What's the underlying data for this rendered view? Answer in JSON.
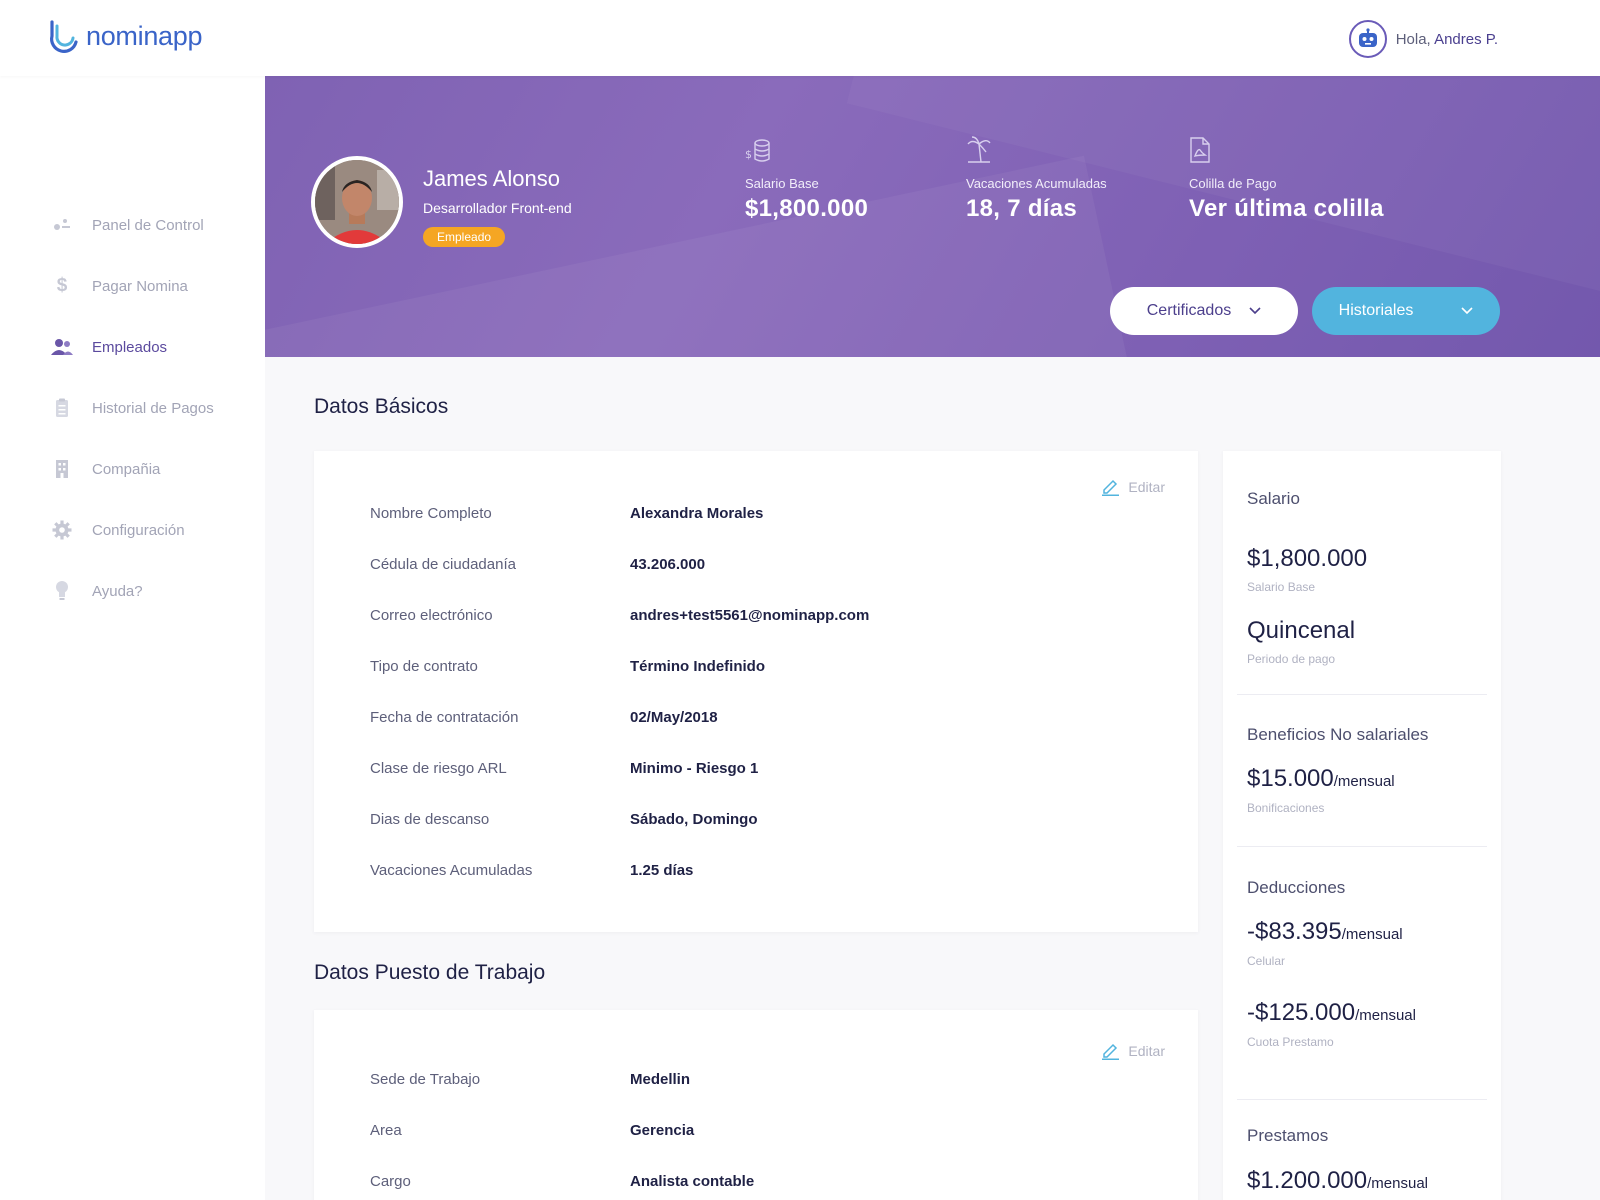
{
  "brand": {
    "name": "nominapp"
  },
  "user": {
    "greeting": "Hola,",
    "name": "Andres P."
  },
  "sidebar": {
    "items": [
      {
        "label": "Panel de Control",
        "icon": "dashboard-icon"
      },
      {
        "label": "Pagar Nomina",
        "icon": "dollar-icon"
      },
      {
        "label": "Empleados",
        "icon": "people-icon",
        "active": true
      },
      {
        "label": "Historial de Pagos",
        "icon": "clipboard-icon"
      },
      {
        "label": "Compañia",
        "icon": "building-icon"
      },
      {
        "label": "Configuración",
        "icon": "gear-icon"
      },
      {
        "label": "Ayuda?",
        "icon": "lightbulb-icon"
      }
    ]
  },
  "employee": {
    "name": "James Alonso",
    "role": "Desarrollador Front-end",
    "badge": "Empleado"
  },
  "stats": [
    {
      "label": "Salario Base",
      "value": "$1,800.000",
      "icon": "coins-icon"
    },
    {
      "label": "Vacaciones Acumuladas",
      "value": "18, 7 días",
      "icon": "palm-tree-icon"
    },
    {
      "label": "Colilla de Pago",
      "value": "Ver última colilla",
      "icon": "pdf-file-icon"
    }
  ],
  "actions": {
    "certificados": "Certificados",
    "historiales": "Historiales"
  },
  "basic": {
    "title": "Datos Básicos",
    "edit": "Editar",
    "rows": [
      {
        "label": "Nombre Completo",
        "value": "Alexandra Morales"
      },
      {
        "label": "Cédula de ciudadanía",
        "value": "43.206.000"
      },
      {
        "label": "Correo electrónico",
        "value": "andres+test5561@nominapp.com"
      },
      {
        "label": "Tipo de contrato",
        "value": "Término Indefinido"
      },
      {
        "label": "Fecha de contratación",
        "value": "02/May/2018"
      },
      {
        "label": "Clase de riesgo ARL",
        "value": "Minimo - Riesgo 1"
      },
      {
        "label": "Dias de descanso",
        "value": "Sábado, Domingo"
      },
      {
        "label": "Vacaciones Acumuladas",
        "value": "1.25 días"
      }
    ]
  },
  "job": {
    "title": "Datos Puesto de Trabajo",
    "edit": "Editar",
    "rows": [
      {
        "label": "Sede de Trabajo",
        "value": "Medellin"
      },
      {
        "label": "Area",
        "value": "Gerencia"
      },
      {
        "label": "Cargo",
        "value": "Analista contable"
      }
    ]
  },
  "summary": {
    "salario": {
      "title": "Salario",
      "amount": "$1,800.000",
      "amount_sub": "Salario Base",
      "period": "Quincenal",
      "period_sub": "Periodo de pago"
    },
    "beneficios": {
      "title": "Beneficios No salariales",
      "amount": "$15.000",
      "unit": "/mensual",
      "sub": "Bonificaciones"
    },
    "deducciones": {
      "title": "Deducciones",
      "items": [
        {
          "amount": "-$83.395",
          "unit": "/mensual",
          "sub": "Celular"
        },
        {
          "amount": "-$125.000",
          "unit": "/mensual",
          "sub": "Cuota Prestamo"
        }
      ]
    },
    "prestamos": {
      "title": "Prestamos",
      "amount": "$1.200.000",
      "unit": "/mensual"
    }
  },
  "colors": {
    "accent": "#7f62b3",
    "badge": "#f5a623",
    "button_blue": "#52b4de"
  }
}
